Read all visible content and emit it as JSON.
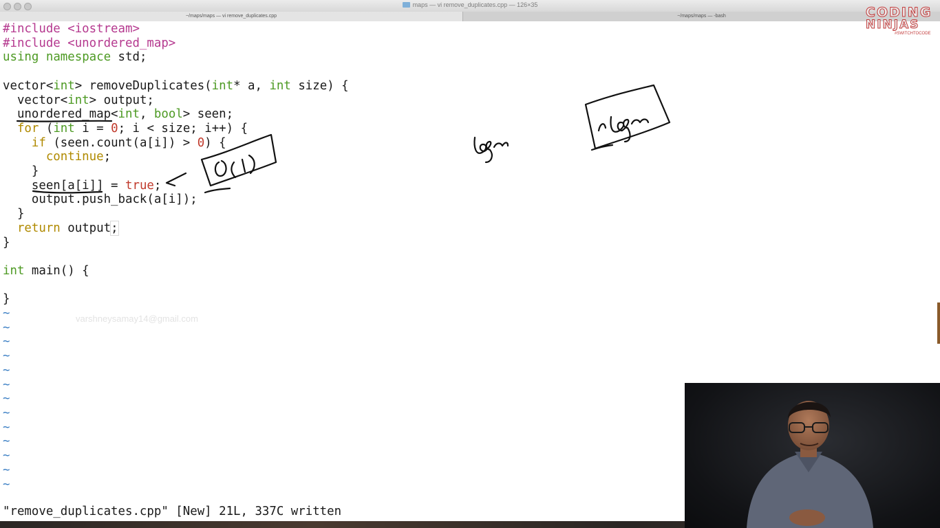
{
  "window": {
    "title": "maps — vi remove_duplicates.cpp — 126×35",
    "tabs": [
      {
        "label": "~/maps/maps — vi remove_duplicates.cpp"
      },
      {
        "label": "~/maps/maps — -bash"
      }
    ]
  },
  "editor": {
    "code_lines": [
      "#include <iostream>",
      "#include <unordered_map>",
      "using namespace std;",
      "",
      "vector<int> removeDuplicates(int* a, int size) {",
      "  vector<int> output;",
      "  unordered_map<int, bool> seen;",
      "  for (int i = 0; i < size; i++) {",
      "    if (seen.count(a[i]) > 0) {",
      "      continue;",
      "    }",
      "    seen[a[i]] = true;",
      "    output.push_back(a[i]);",
      "  }",
      "  return output;",
      "}",
      "",
      "int main() {",
      "",
      "}"
    ],
    "tilde": "~",
    "empty_line_count": 13,
    "status_message": "\"remove_duplicates.cpp\" [New] 21L, 337C written"
  },
  "overlay": {
    "watermark_email": "varshneysamay14@gmail.com",
    "handwriting": [
      "O(1)",
      "logn",
      "n logn"
    ]
  },
  "brand": {
    "line1": "CODING",
    "line2": "NINJAS",
    "tagline": "#SWITCHTOCODE"
  },
  "colors": {
    "preprocessor": "#b5398f",
    "keyword": "#b08a00",
    "type": "#4d9a23",
    "number": "#c0392b",
    "tilde": "#3b7fc4",
    "ink": "#111111",
    "brand": "#c23a3a"
  }
}
